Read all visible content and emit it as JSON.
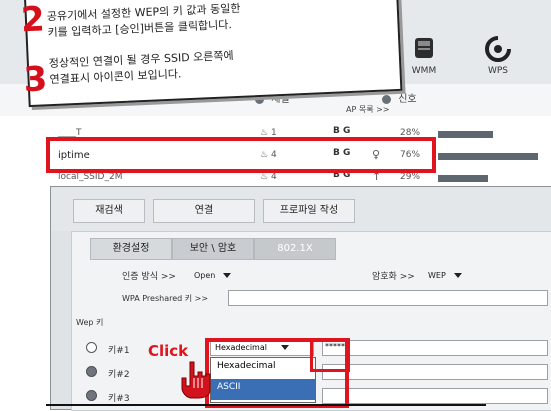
{
  "toolbar": {
    "wmm_label": "WMM",
    "wps_label": "WPS"
  },
  "ap_header": {
    "channel": "채널",
    "signal": "신호",
    "ap_list": "AP 목록 >>"
  },
  "callout": {
    "step2_num": "2",
    "step2_line1": "공유기에서 설정한 WEP의 키 값과 동일한",
    "step2_line2": "키를 입력하고 [승인]버튼을 클릭합니다.",
    "step3_num": "3",
    "step3_line1": "정상적인 연결이 될 경우 SSID 오른쪽에",
    "step3_line2": "연결표시 아이콘이 보입니다."
  },
  "ap_list": [
    {
      "name": "____T",
      "channel": "1",
      "security": "B G",
      "signal": "28%",
      "strength": 0.55
    },
    {
      "name": "iptime",
      "channel": "4",
      "security": "B G",
      "signal": "76%",
      "strength": 1.0
    },
    {
      "name": "local_SSID_2M",
      "channel": "4",
      "security": "B G",
      "signal": "29%",
      "strength": 0.5
    }
  ],
  "front": {
    "btn_rescan": "재검색",
    "btn_connect": "연결",
    "btn_profile": "프로파일 작성",
    "tab_env": "환경설정",
    "tab_security": "보안 \\ 암호",
    "tab_8021x": "802.1X",
    "auth_label": "인증 방식 >>",
    "auth_value": "Open",
    "enc_label": "암호화 >>",
    "enc_value": "WEP",
    "wpa_label": "WPA Preshared 키 >>",
    "wep_label": "Wep 키",
    "key1_label": "키#1",
    "key2_label": "키#2",
    "key3_label": "키#3",
    "key1_format": "Hexadecimal",
    "key1_value": "*****",
    "dropdown_opt1": "Hexadecimal",
    "dropdown_opt2": "ASCII",
    "click_label": "Click"
  },
  "colors": {
    "highlight": "#e0141e",
    "step_number": "#d5101c"
  }
}
